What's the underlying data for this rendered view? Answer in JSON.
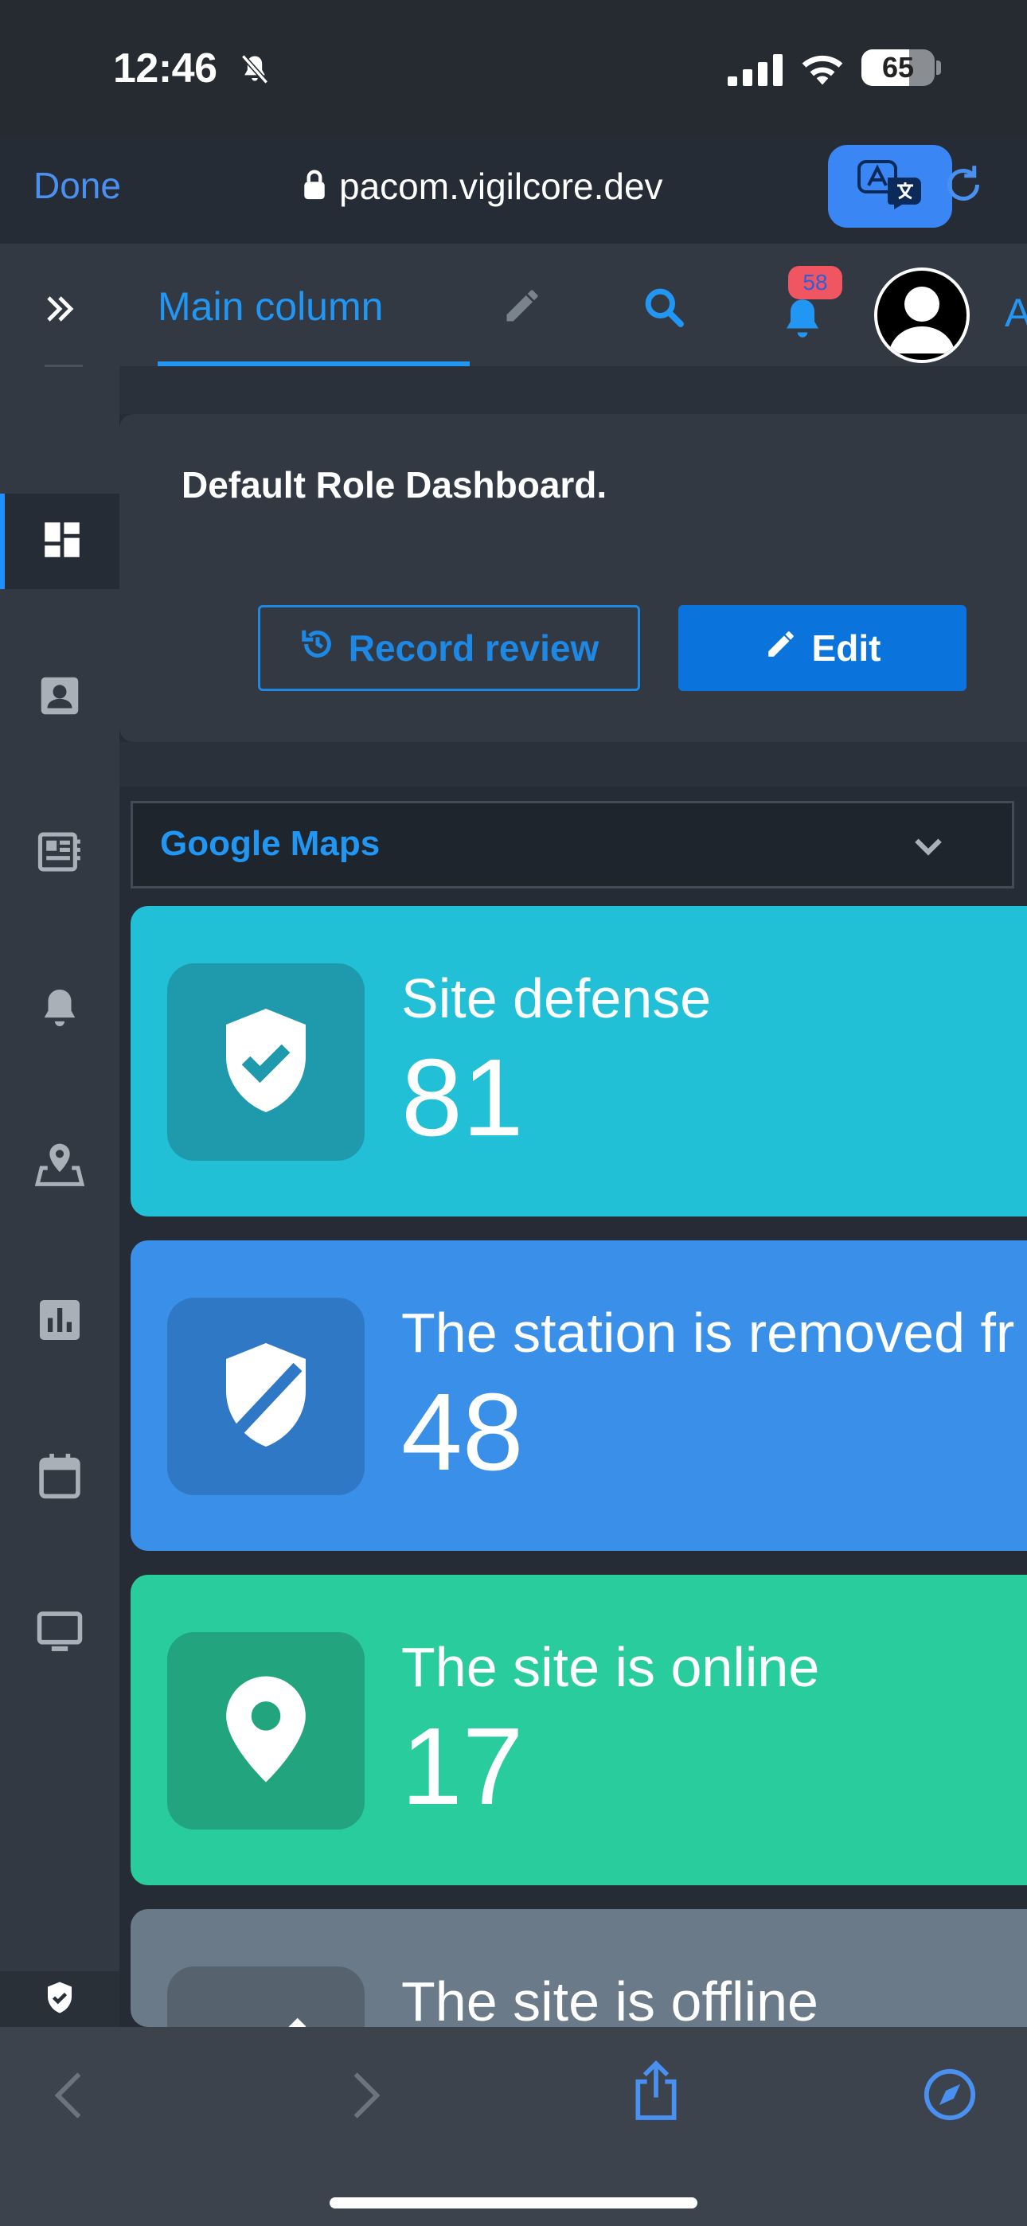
{
  "status_bar": {
    "time": "12:46",
    "battery": "65",
    "battery_level": 0.65
  },
  "browser": {
    "done_label": "Done",
    "url": "pacom.vigilcore.dev"
  },
  "header": {
    "tab_main_label": "Main column",
    "notification_count": "58",
    "cut_text": "A"
  },
  "dashboard": {
    "title": "Default Role Dashboard.",
    "record_review_label": "Record review",
    "edit_label": "Edit"
  },
  "map_select": {
    "value": "Google Maps"
  },
  "stats": [
    {
      "label": "Site defense",
      "value": "81",
      "color": "#22c0d6",
      "icon_bg": "#1f9aad",
      "icon": "shield-check-icon"
    },
    {
      "label": "The station is removed fr",
      "value": "48",
      "color": "#3a90e8",
      "icon_bg": "#2f78c5",
      "icon": "shield-off-icon"
    },
    {
      "label": "The site is online",
      "value": "17",
      "color": "#28cc9d",
      "icon_bg": "#22a47e",
      "icon": "map-pin-icon"
    },
    {
      "label": "The site is offline",
      "value": "",
      "color": "#6b7a88",
      "icon_bg": "#56626e",
      "icon": "offline-icon"
    }
  ],
  "colors": {
    "accent": "#2196f3",
    "sidebar_bg": "#323943",
    "page_bg": "#262c35",
    "badge": "#f05562"
  }
}
